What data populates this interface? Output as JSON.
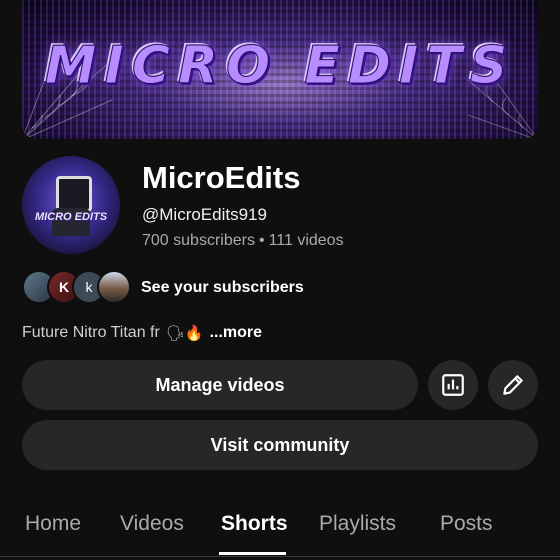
{
  "banner": {
    "text": "MICRO EDITS"
  },
  "avatar": {
    "text": "MICRO EDITS"
  },
  "channel": {
    "name": "MicroEdits",
    "handle": "@MicroEdits919",
    "subscribers": "700 subscribers",
    "separator": "•",
    "videos": "111 videos"
  },
  "subscribers_preview": {
    "avatars": [
      "",
      "K",
      "k",
      ""
    ],
    "label": "See your subscribers"
  },
  "description": {
    "text": "Future Nitro Titan fr",
    "emojis": "🗣🔥",
    "more_label": "...more"
  },
  "buttons": {
    "manage": "Manage videos",
    "community": "Visit community",
    "stats_icon": "analytics-icon",
    "edit_icon": "pencil-icon"
  },
  "tabs": [
    {
      "label": "Home"
    },
    {
      "label": "Videos"
    },
    {
      "label": "Shorts"
    },
    {
      "label": "Playlists"
    },
    {
      "label": "Posts"
    }
  ],
  "active_tab": "Shorts"
}
